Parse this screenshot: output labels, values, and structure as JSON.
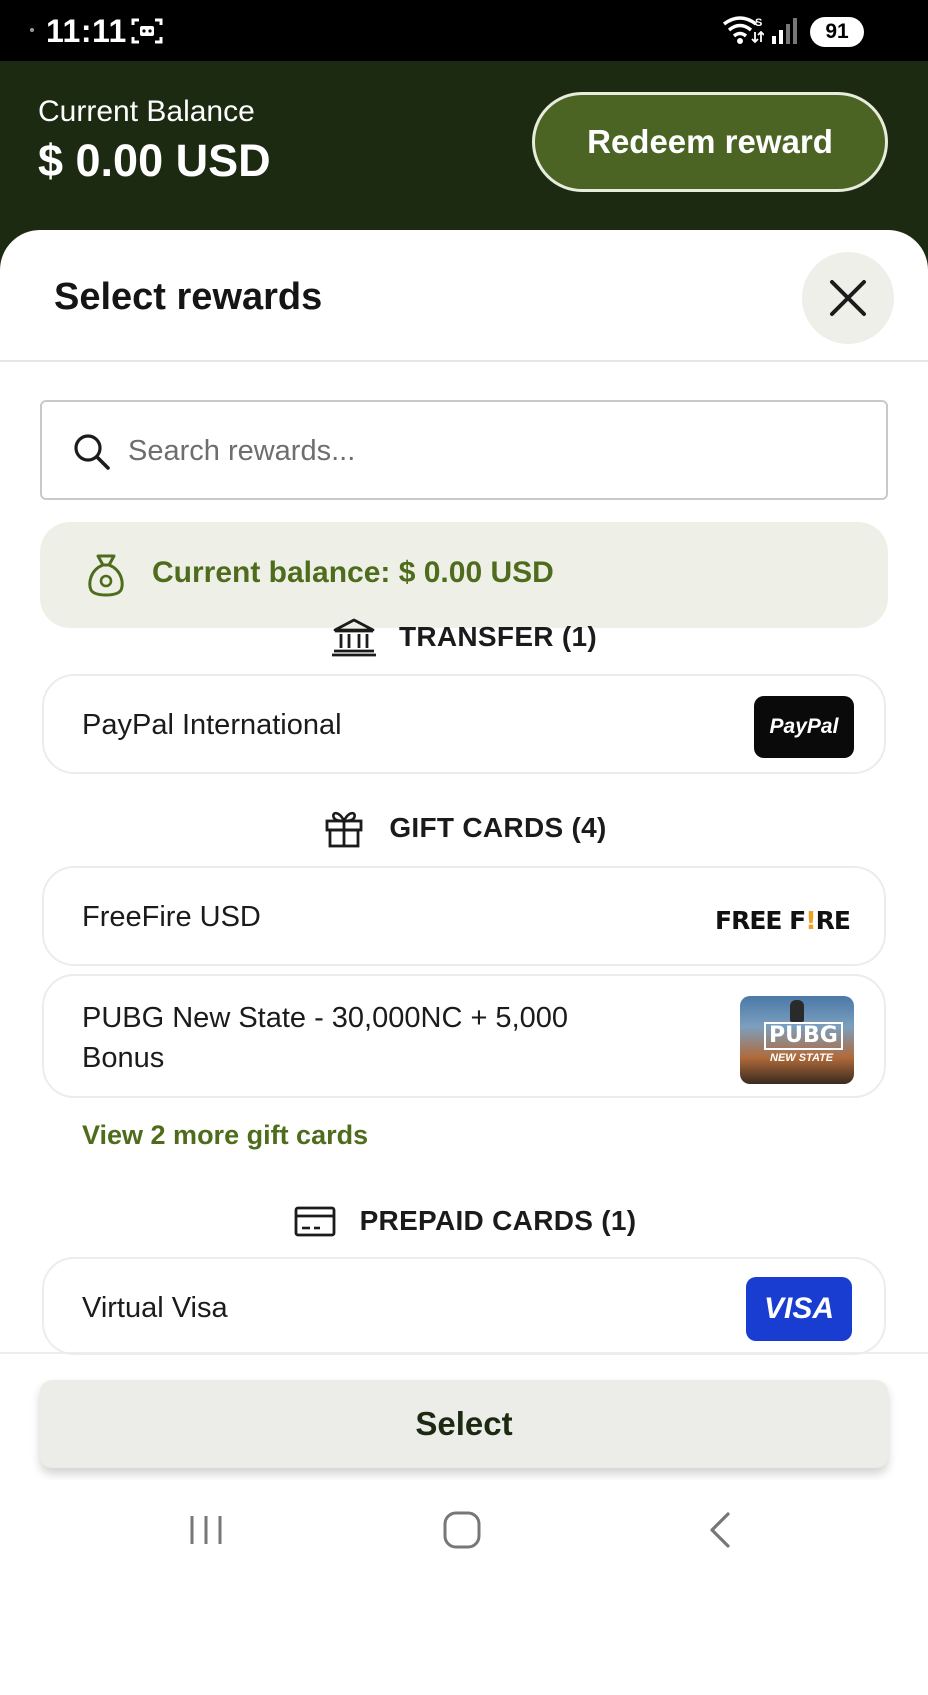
{
  "status_bar": {
    "time": "11:11",
    "battery": "91",
    "icons": [
      "screenshot-icon",
      "wifi-icon",
      "signal-icon",
      "battery-icon"
    ]
  },
  "header": {
    "balance_label": "Current Balance",
    "balance_value": "$ 0.00 USD",
    "redeem_label": "Redeem reward",
    "background_color": "#1d2a12",
    "button_color": "#4b6424"
  },
  "sheet": {
    "title": "Select rewards",
    "close_icon": "close-icon",
    "search": {
      "placeholder": "Search rewards...",
      "value": ""
    },
    "balance_banner": {
      "text": "Current balance: $ 0.00 USD",
      "icon": "money-bag-icon",
      "text_color": "#4e6c1c"
    },
    "sections": [
      {
        "label": "TRANSFER (1)",
        "icon": "bank-icon",
        "items": [
          {
            "name": "PayPal International",
            "logo": "PayPal"
          }
        ]
      },
      {
        "label": "GIFT CARDS (4)",
        "icon": "gift-icon",
        "items": [
          {
            "name": "FreeFire USD",
            "logo_part1": "FREE F",
            "logo_part2": "!",
            "logo_part3": "RE"
          },
          {
            "name": "PUBG New State - 30,000NC + 5,000 Bonus",
            "logo_main": "PUBG",
            "logo_sub": "NEW STATE"
          }
        ],
        "more_link": "View 2 more gift cards"
      },
      {
        "label": "PREPAID CARDS (1)",
        "icon": "card-icon",
        "items": [
          {
            "name": "Virtual Visa",
            "logo": "VISA"
          }
        ]
      }
    ]
  },
  "footer": {
    "select_label": "Select"
  },
  "nav_bar": {
    "icons": [
      "recents-icon",
      "home-icon",
      "back-icon"
    ]
  }
}
